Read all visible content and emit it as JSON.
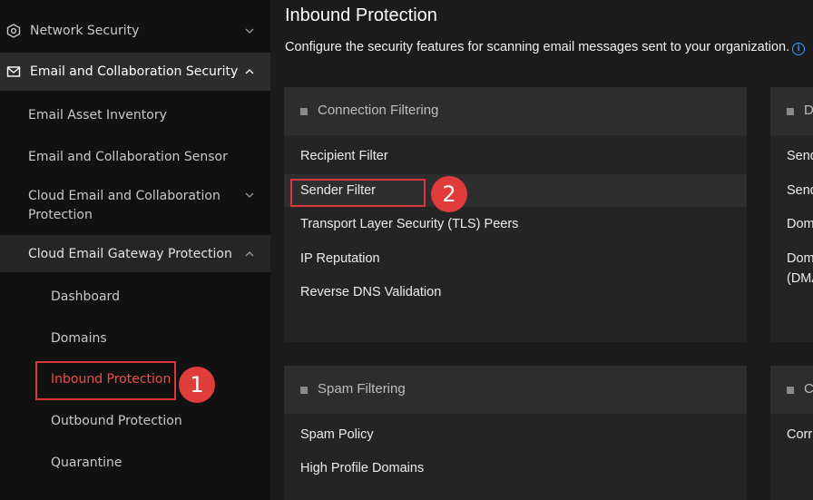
{
  "sidebar": {
    "network_security": "Network Security",
    "email_collab_security": "Email and Collaboration Security",
    "email_asset_inventory": "Email Asset Inventory",
    "email_collab_sensor": "Email and Collaboration Sensor",
    "cloud_email_collab_protection_line1": "Cloud Email and Collaboration",
    "cloud_email_collab_protection_line2": "Protection",
    "cloud_email_gateway_protection": "Cloud Email Gateway Protection",
    "dashboard": "Dashboard",
    "domains": "Domains",
    "inbound_protection": "Inbound Protection",
    "outbound_protection": "Outbound Protection",
    "quarantine": "Quarantine",
    "active_color": "#ef4d4d"
  },
  "annotations": {
    "step1": "1",
    "step2": "2",
    "highlight_color": "#d9363e"
  },
  "main": {
    "title": "Inbound Protection",
    "description": "Configure the security features for scanning email messages sent to your organization.",
    "cards": {
      "connection_filtering": {
        "title": "Connection Filtering",
        "items": [
          "Recipient Filter",
          "Sender Filter",
          "Transport Layer Security (TLS) Peers",
          "IP Reputation",
          "Reverse DNS Validation"
        ]
      },
      "right_top": {
        "title": "D",
        "items": [
          "Send",
          "Send",
          "Dom",
          "Dom",
          "(DMA"
        ]
      },
      "spam_filtering": {
        "title": "Spam Filtering",
        "items": [
          "Spam Policy",
          "High Profile Domains"
        ]
      },
      "right_bottom": {
        "title": "C",
        "items": [
          "Corr"
        ]
      }
    }
  }
}
